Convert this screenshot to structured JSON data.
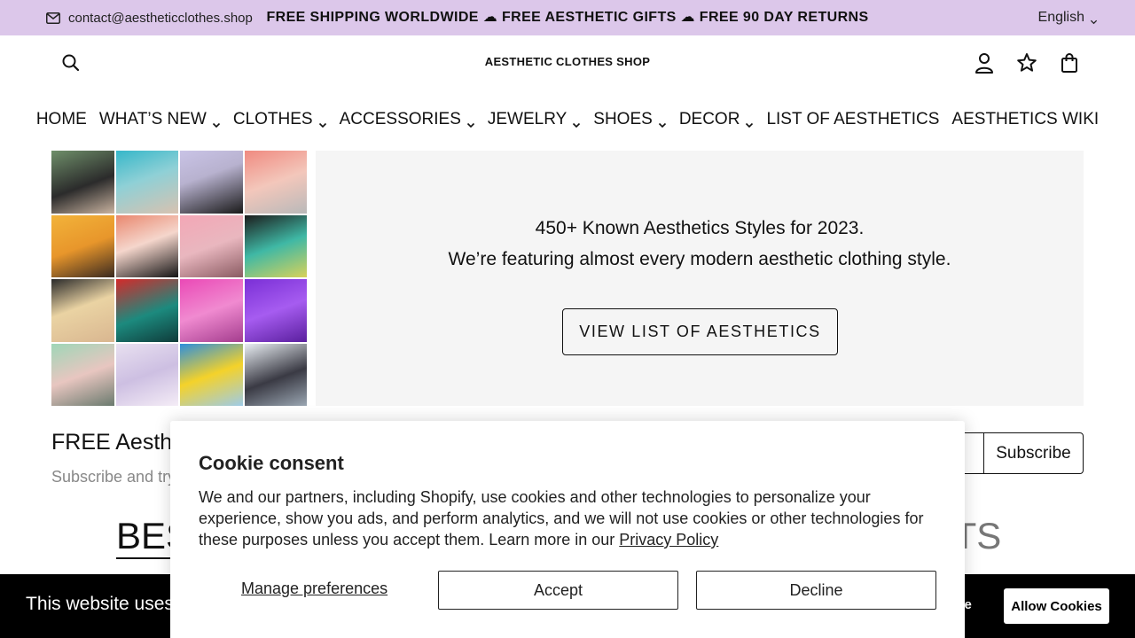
{
  "topbar": {
    "email": "contact@aestheticclothes.shop",
    "announcement": "FREE SHIPPING WORLDWIDE ☁ FREE AESTHETIC GIFTS ☁ FREE 90 DAY RETURNS",
    "language": "English",
    "bg_color": "#dcc7ea"
  },
  "header": {
    "logo": "AESTHETIC CLOTHES SHOP",
    "icons": [
      "search-icon",
      "account-icon",
      "wishlist-star-icon",
      "cart-bag-icon"
    ]
  },
  "nav": {
    "items": [
      {
        "label": "HOME",
        "dropdown": false
      },
      {
        "label": "WHAT’S NEW",
        "dropdown": true
      },
      {
        "label": "CLOTHES",
        "dropdown": true
      },
      {
        "label": "ACCESSORIES",
        "dropdown": true
      },
      {
        "label": "JEWELRY",
        "dropdown": true
      },
      {
        "label": "SHOES",
        "dropdown": true
      },
      {
        "label": "DECOR",
        "dropdown": true
      },
      {
        "label": "LIST OF AESTHETICS",
        "dropdown": false
      },
      {
        "label": "AESTHETICS WIKI",
        "dropdown": false
      }
    ]
  },
  "hero": {
    "line1": "450+ Known Aesthetics Styles for 2023.",
    "line2": "We’re featuring almost every modern aesthetic clothing style.",
    "button": "VIEW LIST OF AESTHETICS"
  },
  "newsletter": {
    "title": "FREE Aesthe",
    "subtitle": "Subscribe and try",
    "button": "Subscribe"
  },
  "sections": {
    "tab_left": "BES",
    "tab_right": "RTS"
  },
  "cookie_bar": {
    "text": "This website uses c",
    "decline": "line",
    "allow": "Allow Cookies"
  },
  "cookie_modal": {
    "title": "Cookie consent",
    "body": "We and our partners, including Shopify, use cookies and other technologies to personalize your experience, show you ads, and perform analytics, and we will not use cookies or other technologies for these purposes unless you accept them. Learn more in our ",
    "link": "Privacy Policy",
    "manage": "Manage preferences",
    "accept": "Accept",
    "decline": "Decline"
  }
}
